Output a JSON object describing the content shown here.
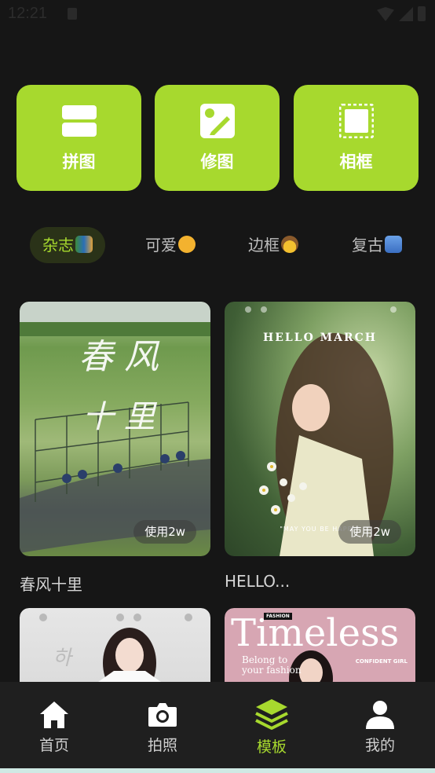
{
  "status": {
    "time": "12:21"
  },
  "tools": [
    {
      "label": "拼图",
      "icon": "collage-icon"
    },
    {
      "label": "修图",
      "icon": "photo-edit-icon"
    },
    {
      "label": "相框",
      "icon": "frame-icon"
    }
  ],
  "tabs": [
    {
      "label": "杂志",
      "emoji": "books-emoji",
      "active": true
    },
    {
      "label": "可爱",
      "emoji": "party-face-emoji",
      "active": false
    },
    {
      "label": "边框",
      "emoji": "cowboy-face-emoji",
      "active": false
    },
    {
      "label": "复古",
      "emoji": "castle-emoji",
      "active": false
    }
  ],
  "templates": [
    {
      "title": "春风十里",
      "usage": "使用2w",
      "overlay_text": "春风 十里"
    },
    {
      "title": "HELLO...",
      "usage": "使用2w",
      "overlay_text": "HELLO MARCH",
      "caption": "\"MAY YOU BE HAPPY\""
    },
    {
      "title": "",
      "usage": "",
      "overlay_text": ""
    },
    {
      "title": "",
      "usage": "",
      "overlay_text": "Timeless",
      "subtext": "Belong to your fashion",
      "badge": "FASHION",
      "tag": "CONFIDENT GIRL"
    }
  ],
  "nav": [
    {
      "label": "首页",
      "icon": "home-icon",
      "active": false
    },
    {
      "label": "拍照",
      "icon": "camera-icon",
      "active": false
    },
    {
      "label": "模板",
      "icon": "layers-icon",
      "active": true
    },
    {
      "label": "我的",
      "icon": "profile-icon",
      "active": false
    }
  ],
  "colors": {
    "accent": "#a7d92e",
    "background": "#161616",
    "nav_bg": "#1f1f1f"
  }
}
